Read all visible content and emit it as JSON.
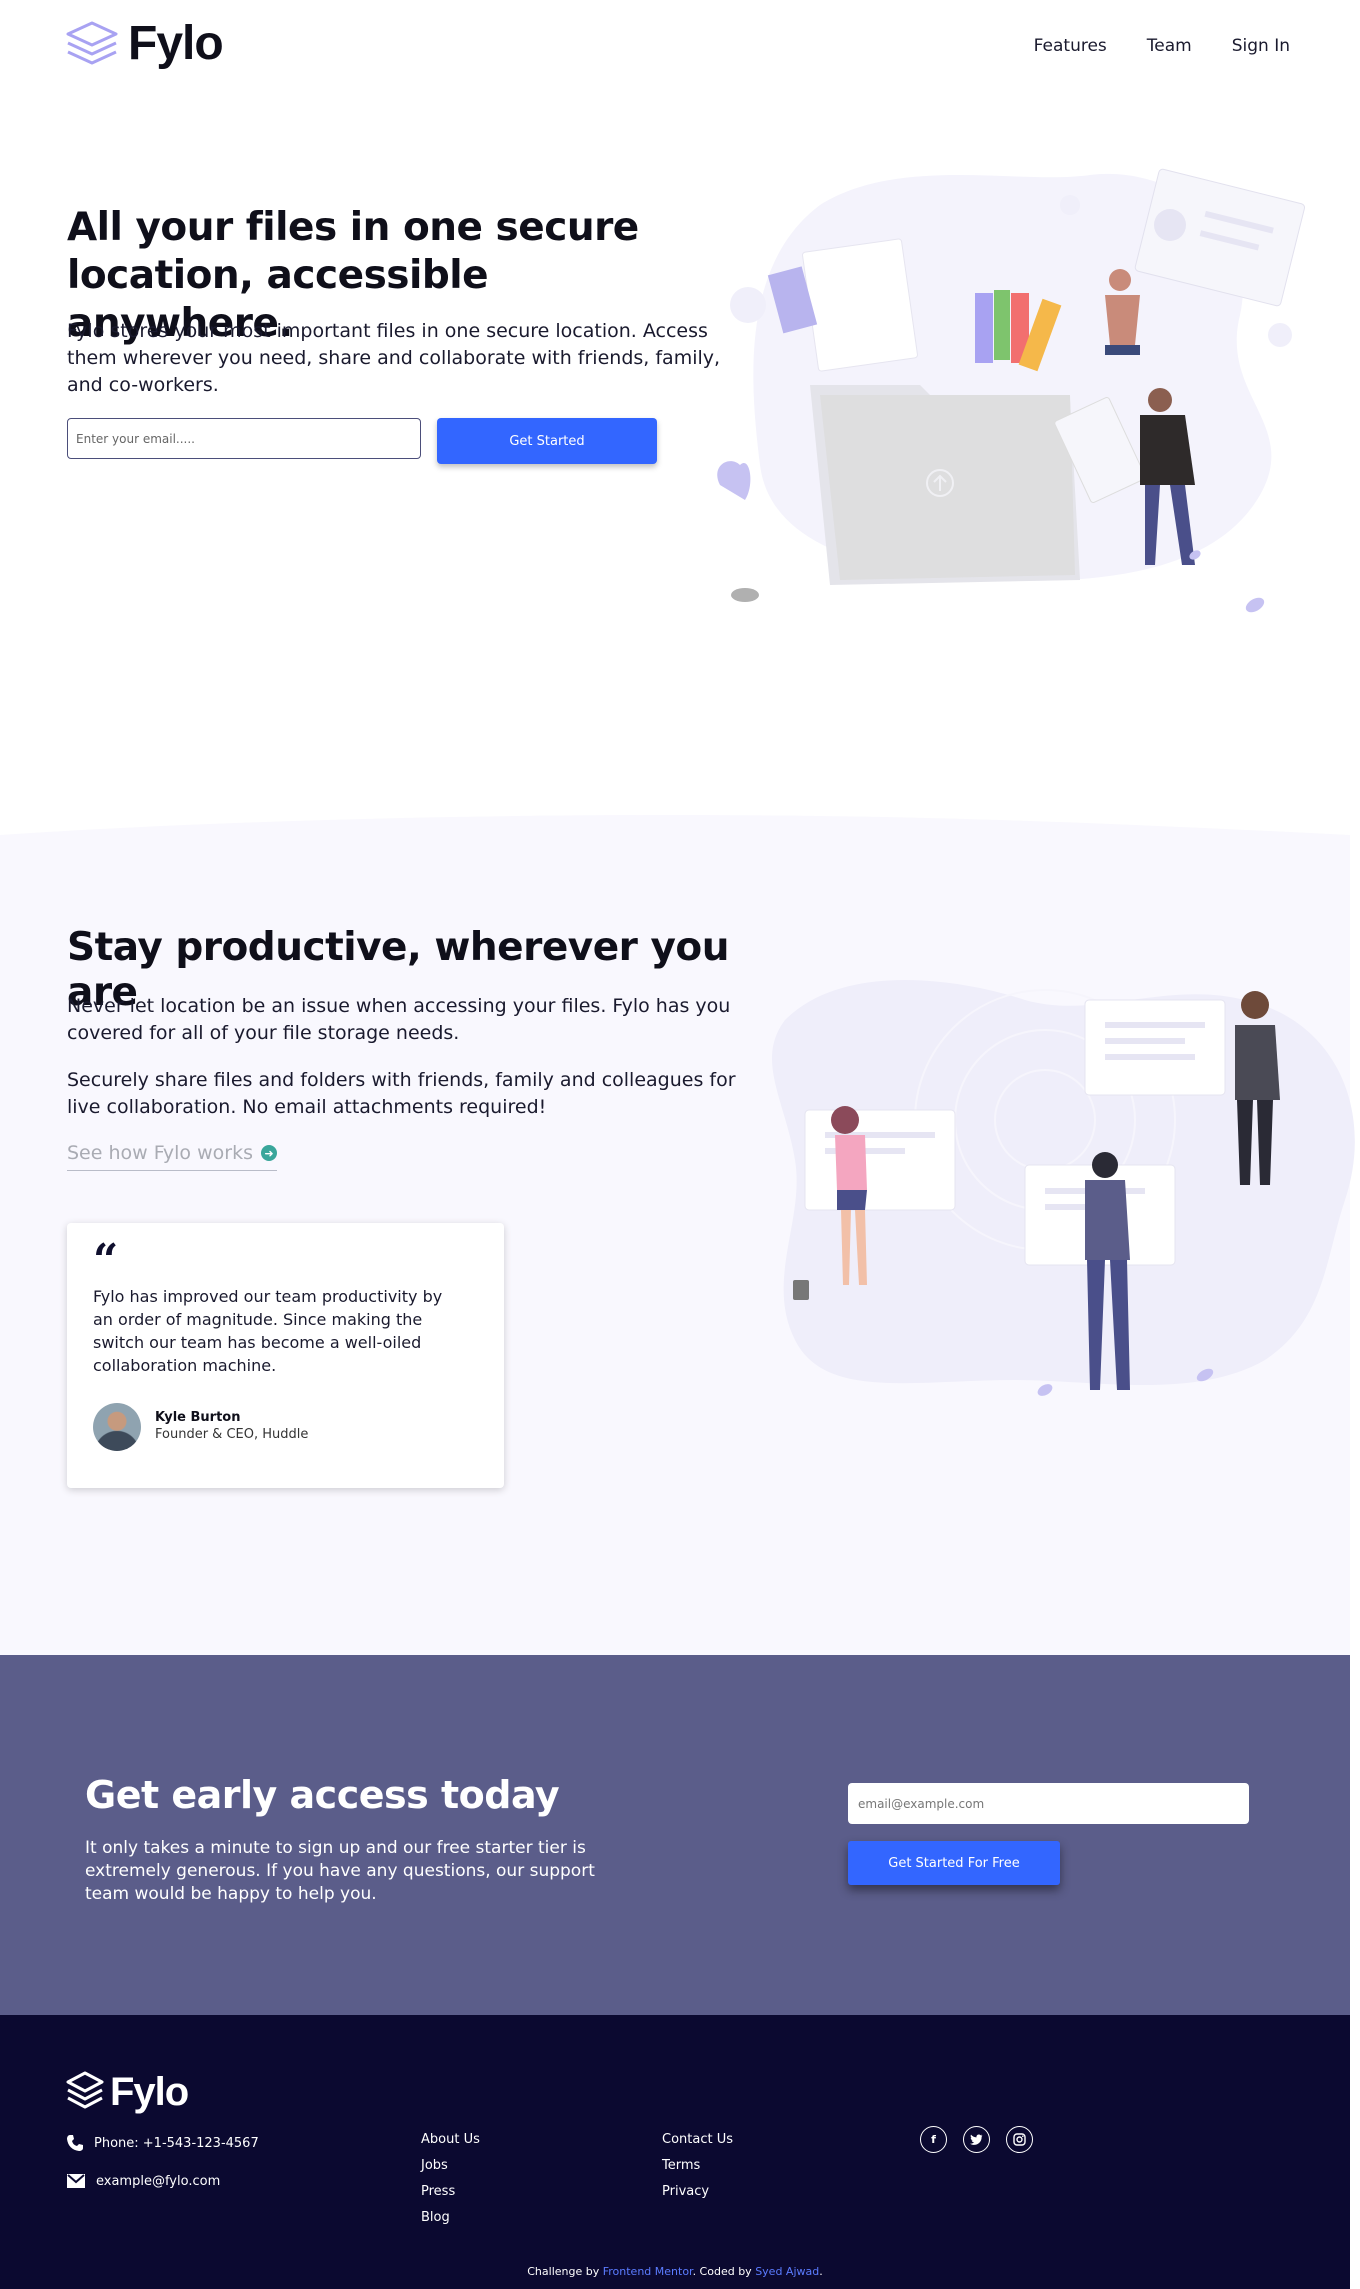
{
  "header": {
    "logo_text": "Fylo",
    "nav": [
      "Features",
      "Team",
      "Sign In"
    ]
  },
  "hero": {
    "title": "All your files in one secure location, accessible anywhere.",
    "text": "Fylo stores your most important files in one secure location. Access them wherever you need, share and collaborate with friends, family, and co-workers.",
    "email_placeholder": "Enter your email.....",
    "button_label": "Get Started"
  },
  "productive": {
    "title": "Stay productive, wherever you are",
    "p1": "Never let location be an issue when accessing your files. Fylo has you covered for all of your file storage needs.",
    "p2": "Securely share files and folders with friends, family and colleagues for live collaboration. No email attachments required!",
    "link_label": "See how Fylo works",
    "testimonial": {
      "quote": "Fylo has improved our team productivity by an order of magnitude. Since making the switch our team has become a well-oiled collaboration machine.",
      "name": "Kyle Burton",
      "role": "Founder & CEO, Huddle"
    }
  },
  "early_access": {
    "title": "Get early access today",
    "text": "It only takes a minute to sign up and our free starter tier is extremely generous. If you have any questions, our support team would be happy to help you.",
    "email_placeholder": "email@example.com",
    "button_label": "Get Started For Free"
  },
  "footer": {
    "logo_text": "Fylo",
    "phone": "Phone: +1-543-123-4567",
    "email": "example@fylo.com",
    "links_col1": [
      "About Us",
      "Jobs",
      "Press",
      "Blog"
    ],
    "links_col2": [
      "Contact Us",
      "Terms",
      "Privacy"
    ],
    "credit": {
      "prefix": "Challenge by",
      "link1": "Frontend Mentor",
      "middle": ". Coded by",
      "link2": "Syed Ajwad",
      "suffix": "."
    }
  },
  "colors": {
    "primary_button": "#3366ff",
    "early_access_bg": "#5b5d8a",
    "footer_bg": "#0b0930",
    "section_bg": "#f9f8fe",
    "accent_teal": "#3aa69b"
  },
  "icons": [
    "layers-logo-icon",
    "arrow-right-icon",
    "quote-icon",
    "phone-icon",
    "mail-icon",
    "facebook-icon",
    "twitter-icon",
    "instagram-icon"
  ]
}
